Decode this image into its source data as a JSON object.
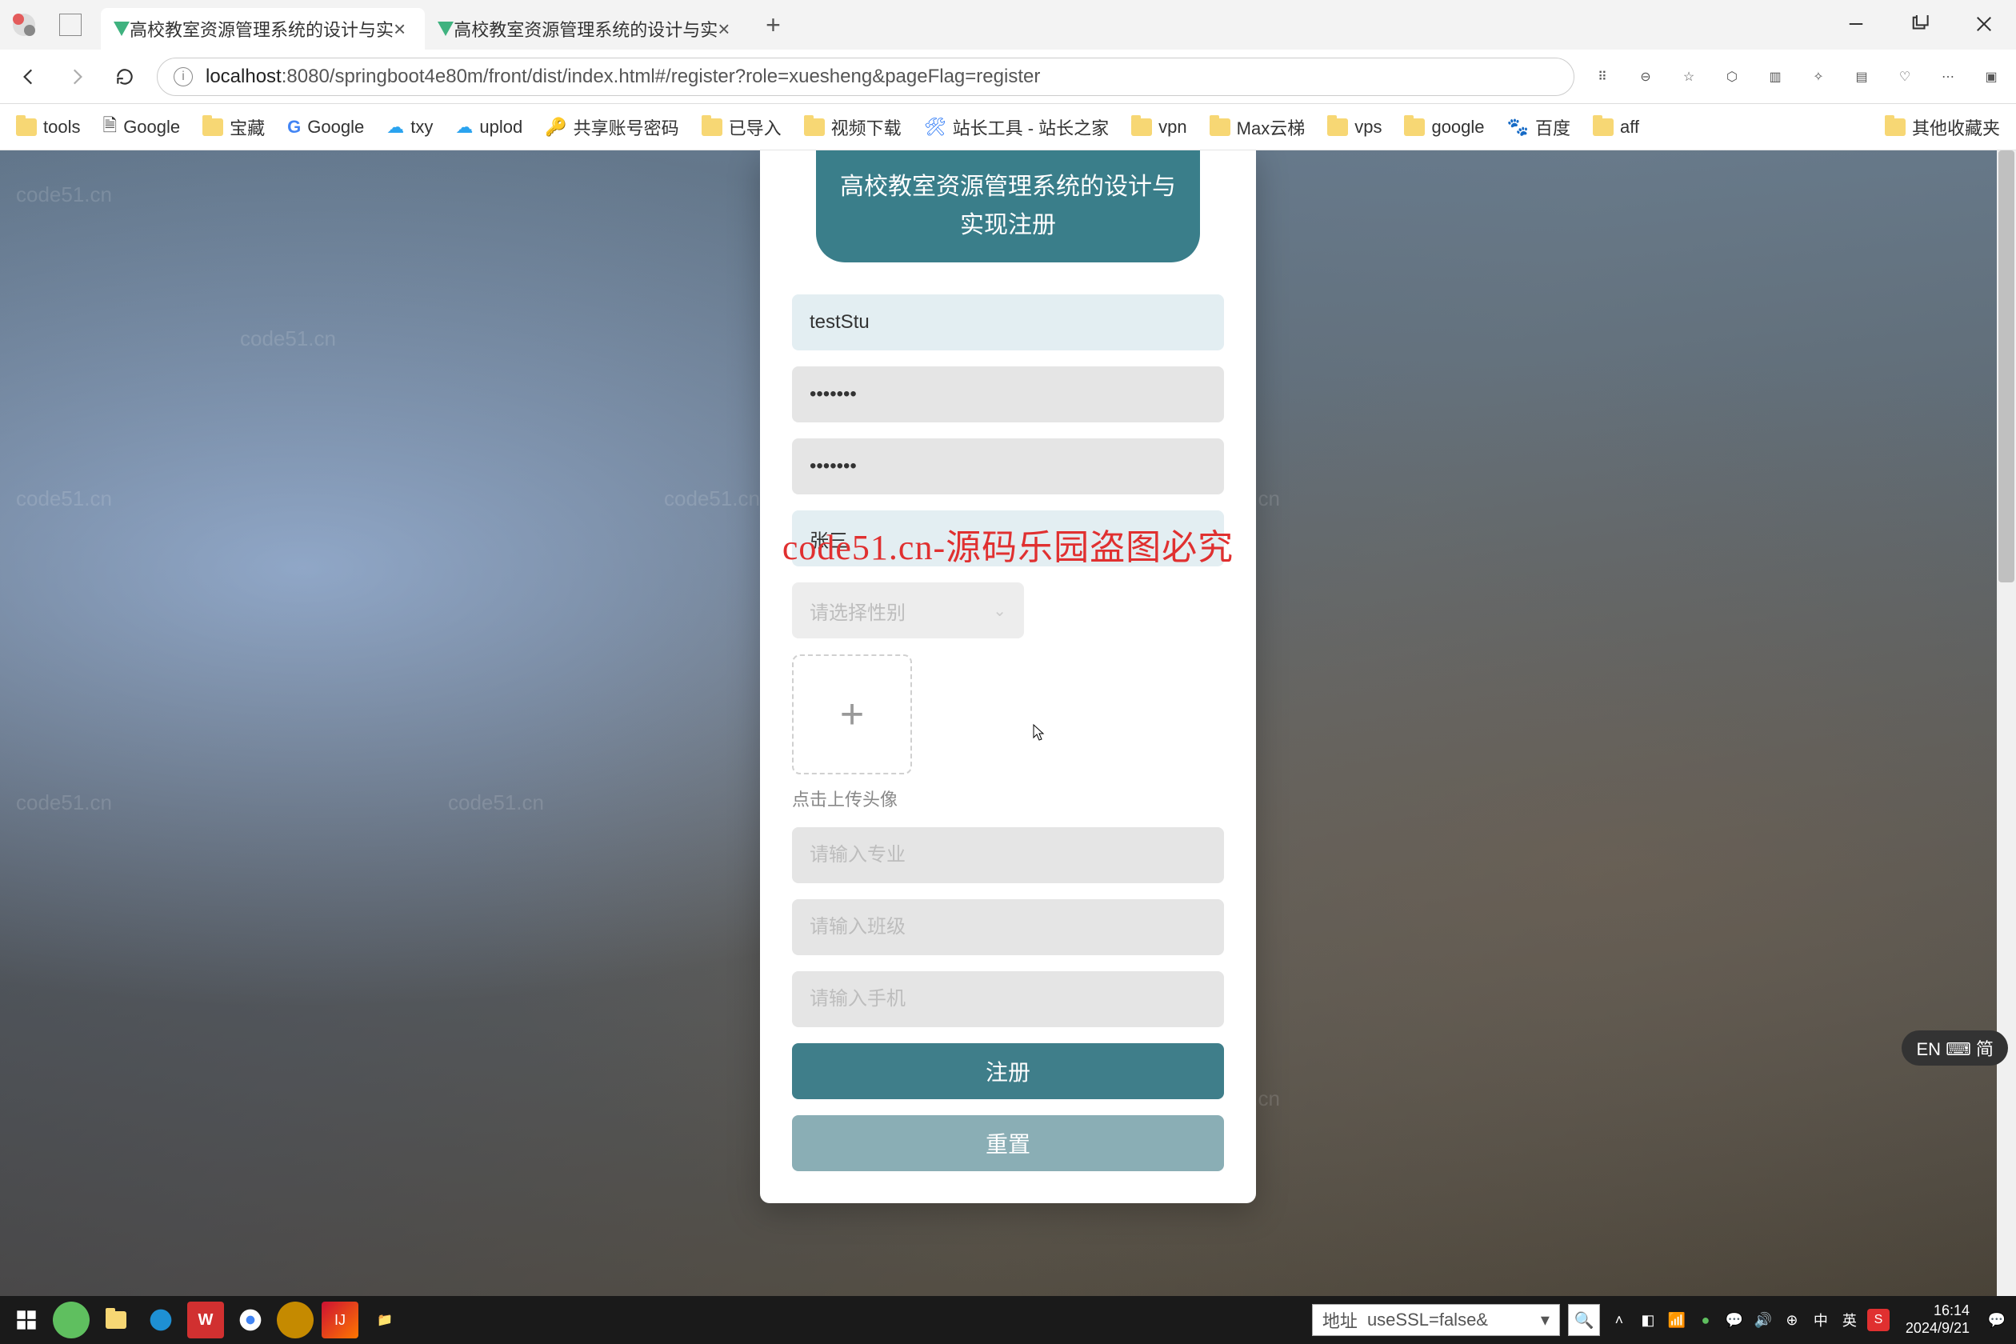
{
  "browser": {
    "tabs": [
      {
        "title": "高校教室资源管理系统的设计与实",
        "active": true
      },
      {
        "title": "高校教室资源管理系统的设计与实",
        "active": false
      }
    ],
    "url_host": "localhost",
    "url_path": ":8080/springboot4e80m/front/dist/index.html#/register?role=xuesheng&pageFlag=register",
    "bookmarks": [
      "tools",
      "Google",
      "宝藏",
      "Google",
      "txy",
      "uplod",
      "共享账号密码",
      "已导入",
      "视频下载",
      "站长工具 - 站长之家",
      "vpn",
      "Max云梯",
      "vps",
      "google",
      "百度",
      "aff"
    ],
    "bookmarks_overflow": "其他收藏夹"
  },
  "watermark_url": "code51.cn",
  "watermark_red": "code51.cn-源码乐园盗图必究",
  "card": {
    "title": "高校教室资源管理系统的设计与实现注册",
    "username_value": "testStu",
    "password_value": "•••••••",
    "password2_value": "•••••••",
    "name_value": "张三",
    "gender_placeholder": "请选择性别",
    "upload_label": "点击上传头像",
    "major_placeholder": "请输入专业",
    "class_placeholder": "请输入班级",
    "phone_placeholder": "请输入手机",
    "register_btn": "注册",
    "reset_btn": "重置"
  },
  "ime_pill": "EN ⌨ 简",
  "taskbar": {
    "addr_label": "地址",
    "addr_value": "useSSL=false&",
    "ime1": "中",
    "ime2": "英",
    "time": "16:14",
    "date": "2024/9/21"
  }
}
